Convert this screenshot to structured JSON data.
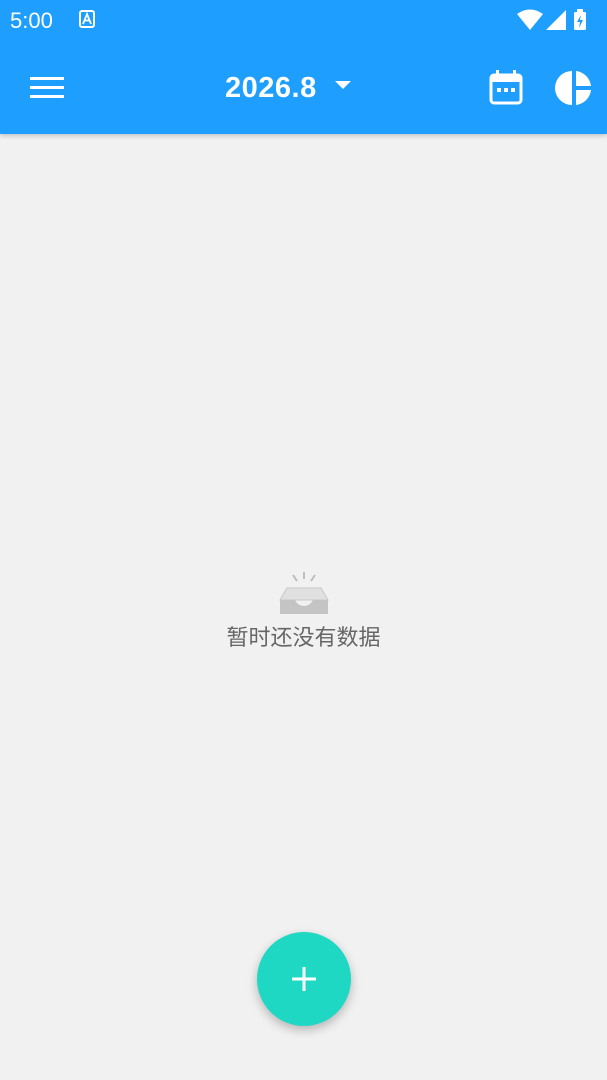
{
  "statusbar": {
    "time": "5:00",
    "notification_icon": "accessibility-a-icon",
    "icons": [
      "wifi-icon",
      "cell-signal-icon",
      "battery-charging-icon"
    ]
  },
  "toolbar": {
    "menu_icon": "hamburger-menu-icon",
    "title": "2026.8",
    "dropdown_icon": "caret-down-icon",
    "calendar_icon": "calendar-icon",
    "chart_icon": "pie-chart-icon"
  },
  "empty_state": {
    "icon": "empty-inbox-icon",
    "message": "暂时还没有数据"
  },
  "fab": {
    "icon": "plus-icon"
  },
  "colors": {
    "primary": "#1e9eff",
    "accent": "#1ed8c4",
    "background": "#f1f1f1",
    "empty_text": "#666666"
  }
}
